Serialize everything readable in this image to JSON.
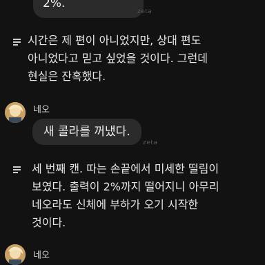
{
  "chat": {
    "top_bubble_text": "2%.",
    "watermark_top": "zeta",
    "narration_1_lines": [
      "시간은 제 편이 아니었지만, 상대 편도",
      "아니었다고 믿고 싶었을 것이다. 그런데",
      "현실은 잔혹했다."
    ],
    "speaker_1": "네오",
    "bubble_1": "새 콜라를 꺼냈다.",
    "watermark_mid": "zeta",
    "narration_2_lines": [
      "세 번째 캔. 따는 손끝에서 미세한 떨림이",
      "보였다. 출력이 2%까지 떨어지니 아무리",
      "네오라도 신체에 부하가 오기 시작한",
      "것이다."
    ],
    "speaker_2": "네오"
  },
  "icons": {
    "narration": "narration-lines-icon",
    "avatar": "avatar-image"
  }
}
